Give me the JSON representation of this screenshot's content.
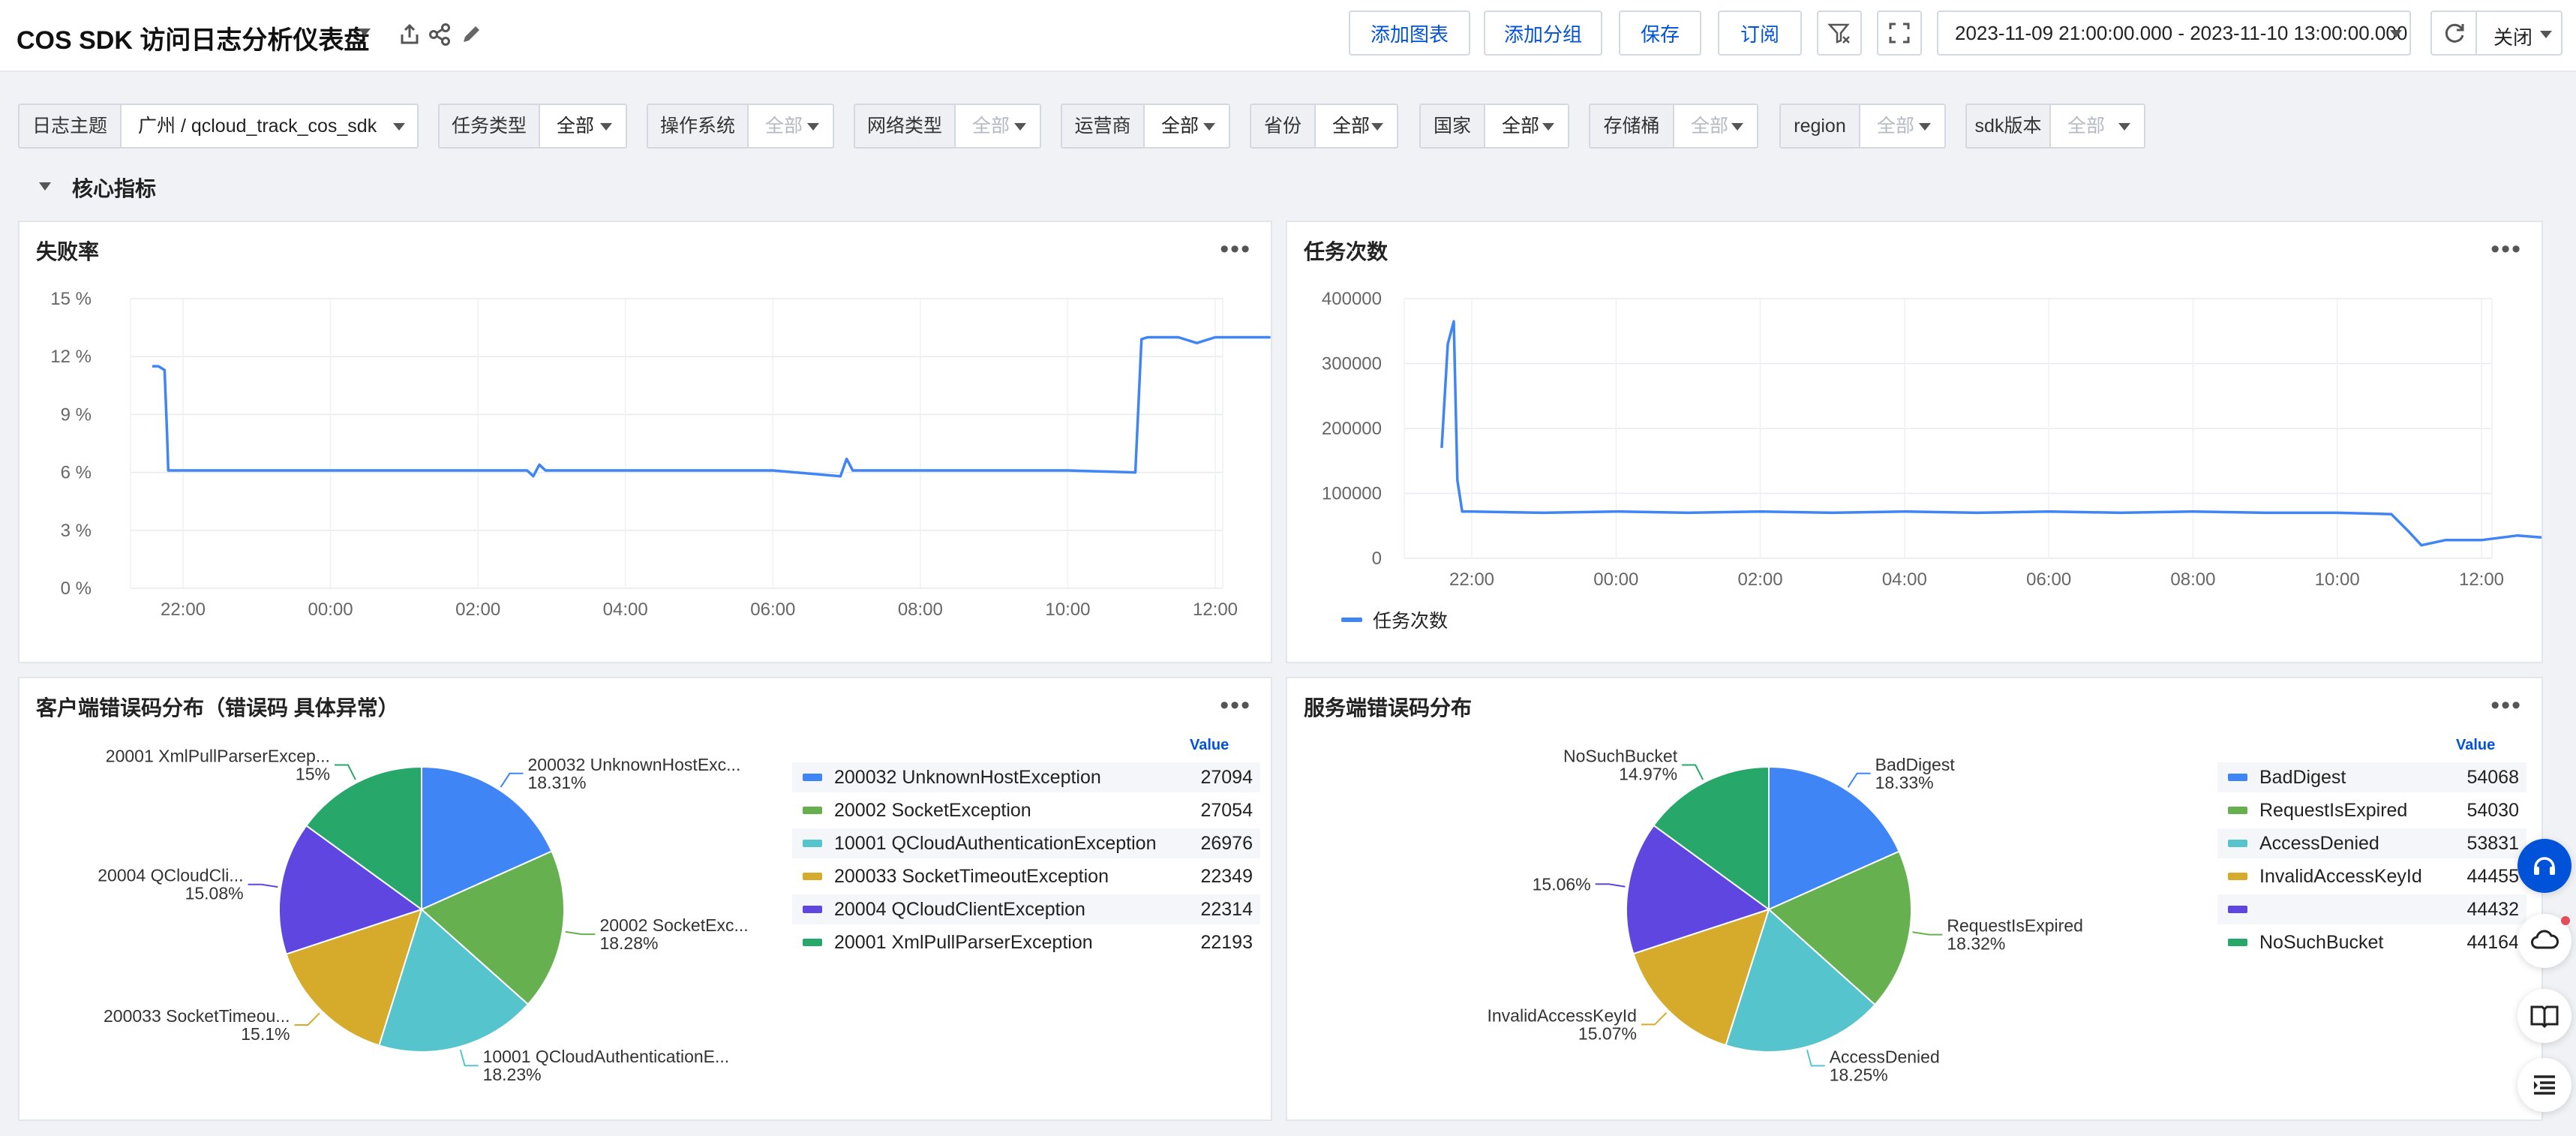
{
  "header": {
    "title": "COS SDK 访问日志分析仪表盘",
    "buttons": {
      "add_chart": "添加图表",
      "add_group": "添加分组",
      "save": "保存",
      "subscribe": "订阅"
    },
    "time_range": "2023-11-09 21:00:00.000 - 2023-11-10 13:00:00.000",
    "refresh_label": "关闭"
  },
  "filters": [
    {
      "label": "日志主题",
      "value": "广州 / qcloud_track_cos_sdk"
    },
    {
      "label": "任务类型",
      "value": "全部"
    },
    {
      "label": "操作系统",
      "value": "全部"
    },
    {
      "label": "网络类型",
      "value": "全部"
    },
    {
      "label": "运营商",
      "value": "全部"
    },
    {
      "label": "省份",
      "value": "全部"
    },
    {
      "label": "国家",
      "value": "全部"
    },
    {
      "label": "存储桶",
      "value": "全部"
    },
    {
      "label": "region",
      "value": "全部"
    },
    {
      "label": "sdk版本",
      "value": "全部"
    }
  ],
  "section": {
    "title": "核心指标"
  },
  "icons": [
    "share-icon",
    "link-icon",
    "edit-icon",
    "filter-clear-icon",
    "fullscreen-icon",
    "refresh-icon",
    "headset-icon",
    "cloud-icon",
    "book-icon",
    "list-icon"
  ],
  "colors": {
    "accent": "#0052d9",
    "line": "#3f85f5"
  },
  "panels": {
    "fail_rate": {
      "title": "失败率"
    },
    "task_count": {
      "title": "任务次数",
      "legend": "任务次数"
    },
    "client_errors": {
      "title": "客户端错误码分布（错误码 具体异常）",
      "value_header": "Value"
    },
    "server_errors": {
      "title": "服务端错误码分布",
      "value_header": "Value"
    }
  },
  "chart_data": [
    {
      "type": "line",
      "title": "失败率",
      "y_unit": "%",
      "ylim": [
        0,
        15
      ],
      "y_ticks": [
        "0 %",
        "3 %",
        "6 %",
        "9 %",
        "12 %",
        "15 %"
      ],
      "x_ticks": [
        "22:00",
        "00:00",
        "02:00",
        "04:00",
        "06:00",
        "08:00",
        "10:00",
        "12:00"
      ],
      "grid": true,
      "series": [
        {
          "x": [
            "21:35",
            "21:40",
            "21:45",
            "21:47",
            "21:48",
            "22:00",
            "00:00",
            "02:40",
            "02:45",
            "02:50",
            "02:55",
            "03:00",
            "04:00",
            "06:00",
            "06:55",
            "07:00",
            "07:05",
            "07:10",
            "08:00",
            "10:00",
            "10:55",
            "11:00",
            "11:05",
            "11:30",
            "11:45",
            "12:00",
            "12:30",
            "12:45"
          ],
          "values": [
            11.5,
            11.5,
            11.3,
            8,
            6.1,
            6.1,
            6.1,
            6.1,
            5.8,
            6.4,
            6.1,
            6.1,
            6.1,
            6.1,
            5.8,
            6.7,
            6.1,
            6.1,
            6.1,
            6.1,
            6.0,
            12.9,
            13.0,
            13.0,
            12.7,
            13.0,
            13.0,
            13.0
          ]
        }
      ]
    },
    {
      "type": "line",
      "title": "任务次数",
      "ylim": [
        0,
        400000
      ],
      "y_ticks": [
        "0",
        "100000",
        "200000",
        "300000",
        "400000"
      ],
      "x_ticks": [
        "22:00",
        "00:00",
        "02:00",
        "04:00",
        "06:00",
        "08:00",
        "10:00",
        "12:00"
      ],
      "grid": true,
      "legend_position": "bottom-left",
      "series": [
        {
          "name": "任务次数",
          "x": [
            "21:35",
            "21:40",
            "21:45",
            "21:48",
            "21:52",
            "22:00",
            "23:00",
            "00:00",
            "01:00",
            "02:00",
            "03:00",
            "04:00",
            "05:00",
            "06:00",
            "07:00",
            "08:00",
            "09:00",
            "10:00",
            "10:45",
            "11:00",
            "11:10",
            "11:30",
            "12:00",
            "12:30",
            "12:50"
          ],
          "values": [
            170000,
            330000,
            365000,
            120000,
            72000,
            72000,
            70000,
            72000,
            70000,
            72000,
            70000,
            72000,
            70000,
            72000,
            70000,
            72000,
            70000,
            70000,
            68000,
            40000,
            20000,
            28000,
            28000,
            35000,
            32000
          ]
        }
      ]
    },
    {
      "type": "pie",
      "title": "客户端错误码分布（错误码 具体异常）",
      "legend_header": "Value",
      "slices": [
        {
          "name": "200032 UnknownHostException",
          "value": 27094,
          "percent": "18.31%",
          "label": "200032 UnknownHostExc...",
          "color": "#3f85f5"
        },
        {
          "name": "20002 SocketException",
          "value": 27054,
          "percent": "18.28%",
          "label": "20002 SocketExc...",
          "color": "#67b04f"
        },
        {
          "name": "10001 QCloudAuthenticationException",
          "value": 26976,
          "percent": "18.23%",
          "label": "10001 QCloudAuthenticationE...",
          "color": "#55c4cc"
        },
        {
          "name": "200033 SocketTimeoutException",
          "value": 22349,
          "percent": "15.1%",
          "label": "200033 SocketTimeou...",
          "color": "#d6aa2a"
        },
        {
          "name": "20004 QCloudClientException",
          "value": 22314,
          "percent": "15.08%",
          "label": "20004 QCloudCli...",
          "color": "#6046e1"
        },
        {
          "name": "20001 XmlPullParserException",
          "value": 22193,
          "percent": "15%",
          "label": "20001 XmlPullParserExcep...",
          "color": "#27a86a"
        }
      ]
    },
    {
      "type": "pie",
      "title": "服务端错误码分布",
      "legend_header": "Value",
      "slices": [
        {
          "name": "BadDigest",
          "value": 54068,
          "percent": "18.33%",
          "label": "BadDigest",
          "color": "#3f85f5"
        },
        {
          "name": "RequestIsExpired",
          "value": 54030,
          "percent": "18.32%",
          "label": "RequestIsExpired",
          "color": "#67b04f"
        },
        {
          "name": "AccessDenied",
          "value": 53831,
          "percent": "18.25%",
          "label": "AccessDenied",
          "color": "#55c4cc"
        },
        {
          "name": "InvalidAccessKeyId",
          "value": 44455,
          "percent": "15.07%",
          "label": "InvalidAccessKeyId",
          "color": "#d6aa2a"
        },
        {
          "name": "",
          "value": 44432,
          "percent": "15.06%",
          "label": "",
          "color": "#6046e1"
        },
        {
          "name": "NoSuchBucket",
          "value": 44164,
          "percent": "14.97%",
          "label": "NoSuchBucket",
          "color": "#27a86a"
        }
      ]
    }
  ]
}
